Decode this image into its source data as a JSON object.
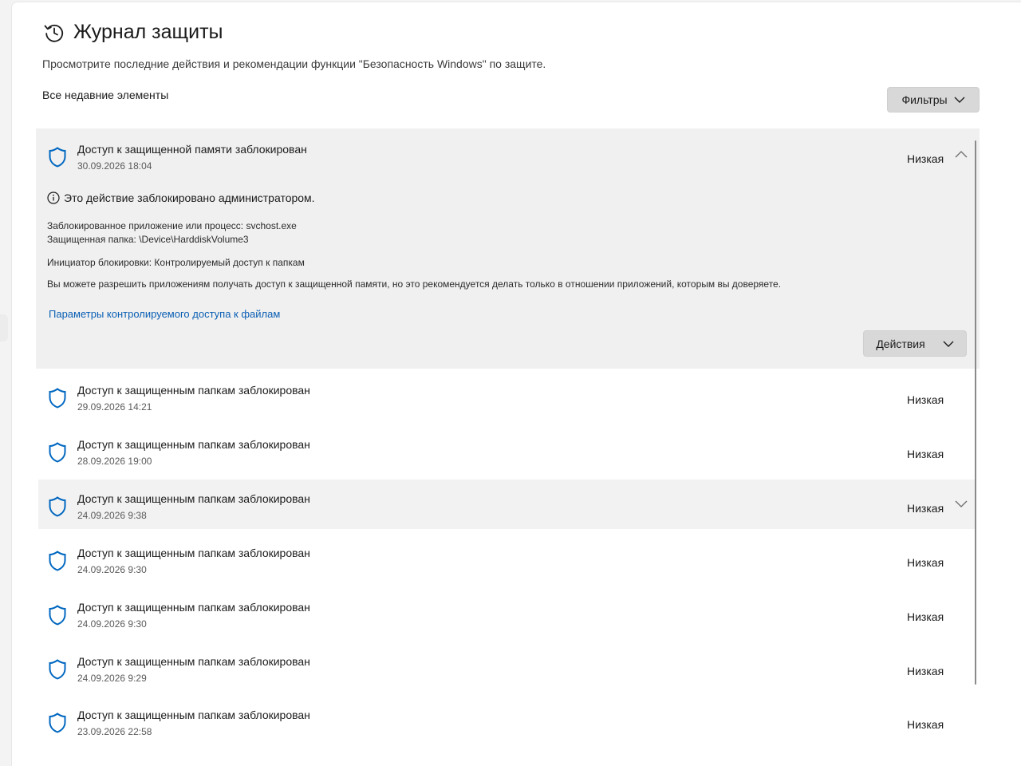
{
  "page": {
    "title": "Журнал защиты",
    "subtitle": "Просмотрите последние действия и рекомендации функции \"Безопасность Windows\" по защите.",
    "section_label": "Все недавние элементы",
    "filters_label": "Фильтры"
  },
  "expanded_item": {
    "title": "Доступ к защищенной памяти заблокирован",
    "date": "30.09.2026 18:04",
    "severity": "Низкая",
    "info_text": "Это действие заблокировано администратором.",
    "blocked_app": "Заблокированное приложение или процесс:  svchost.exe",
    "protected_folder": "Защищенная папка:  \\Device\\HarddiskVolume3",
    "initiator": "Инициатор блокировки:  Контролируемый доступ к папкам",
    "note": "Вы можете разрешить приложениям получать доступ к защищенной памяти, но это рекомендуется делать только в отношении приложений, которым вы доверяете.",
    "link": "Параметры контролируемого доступа к файлам",
    "actions_label": "Действия"
  },
  "items": [
    {
      "title": "Доступ к защищенным папкам заблокирован",
      "date": "29.09.2026 14:21",
      "severity": "Низкая"
    },
    {
      "title": "Доступ к защищенным папкам заблокирован",
      "date": "28.09.2026 19:00",
      "severity": "Низкая"
    },
    {
      "title": "Доступ к защищенным папкам заблокирован",
      "date": "24.09.2026 9:38",
      "severity": "Низкая"
    },
    {
      "title": "Доступ к защищенным папкам заблокирован",
      "date": "24.09.2026 9:30",
      "severity": "Низкая"
    },
    {
      "title": "Доступ к защищенным папкам заблокирован",
      "date": "24.09.2026 9:30",
      "severity": "Низкая"
    },
    {
      "title": "Доступ к защищенным папкам заблокирован",
      "date": "24.09.2026 9:29",
      "severity": "Низкая"
    },
    {
      "title": "Доступ к защищенным папкам заблокирован",
      "date": "23.09.2026 22:58",
      "severity": "Низкая"
    }
  ],
  "icons": {
    "history": "history-icon",
    "shield": "shield-icon",
    "info": "info-icon",
    "chevron": "chevron-down-icon"
  },
  "colors": {
    "accent_shield": "#0067c0",
    "link": "#0a5fb4",
    "button_bg": "#d8d8d8",
    "expanded_bg": "#f0f0f0"
  }
}
